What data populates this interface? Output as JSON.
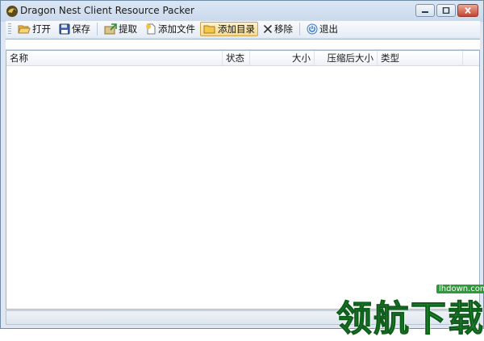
{
  "window": {
    "title": "Dragon Nest Client Resource Packer"
  },
  "toolbar": {
    "open": "打开",
    "save": "保存",
    "extract": "提取",
    "add_file": "添加文件",
    "add_dir": "添加目录",
    "remove": "移除",
    "exit": "退出"
  },
  "list": {
    "columns": [
      "名称",
      "状态",
      "大小",
      "压缩后大小",
      "类型"
    ]
  },
  "watermark": {
    "url": "lhdown.com",
    "text": "领航下载"
  },
  "colors": {
    "accent": "#f7d98d",
    "watermark": "#1f8f30",
    "close": "#c7452f"
  }
}
